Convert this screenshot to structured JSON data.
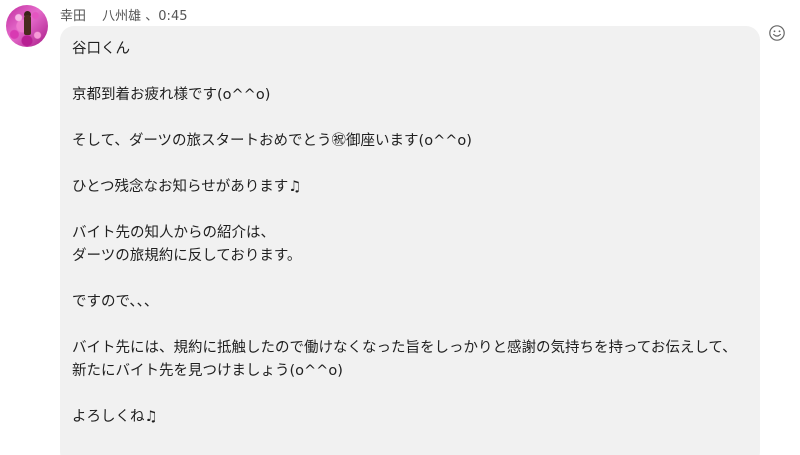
{
  "message": {
    "sender_name": "幸田",
    "sender_detail": "八州雄 、0:45",
    "lines": [
      "谷口くん",
      "",
      "京都到着お疲れ様です(o^^o)",
      "",
      "そして、ダーツの旅スタートおめでとう㊗御座います(o^^o)",
      "",
      "ひとつ残念なお知らせがあります♫",
      "",
      "バイト先の知人からの紹介は、",
      "ダーツの旅規約に反しております。",
      "",
      "ですので、、、",
      "",
      "バイト先には、規約に抵触したので働けなくなった旨をしっかりと感謝の気持ちを持ってお伝えして、",
      "新たにバイト先を見つけましょう(o^^o)",
      "",
      "よろしくね♫"
    ]
  },
  "icons": {
    "avatar": "avatar-flower-field",
    "reaction": "smiley-face-icon"
  }
}
